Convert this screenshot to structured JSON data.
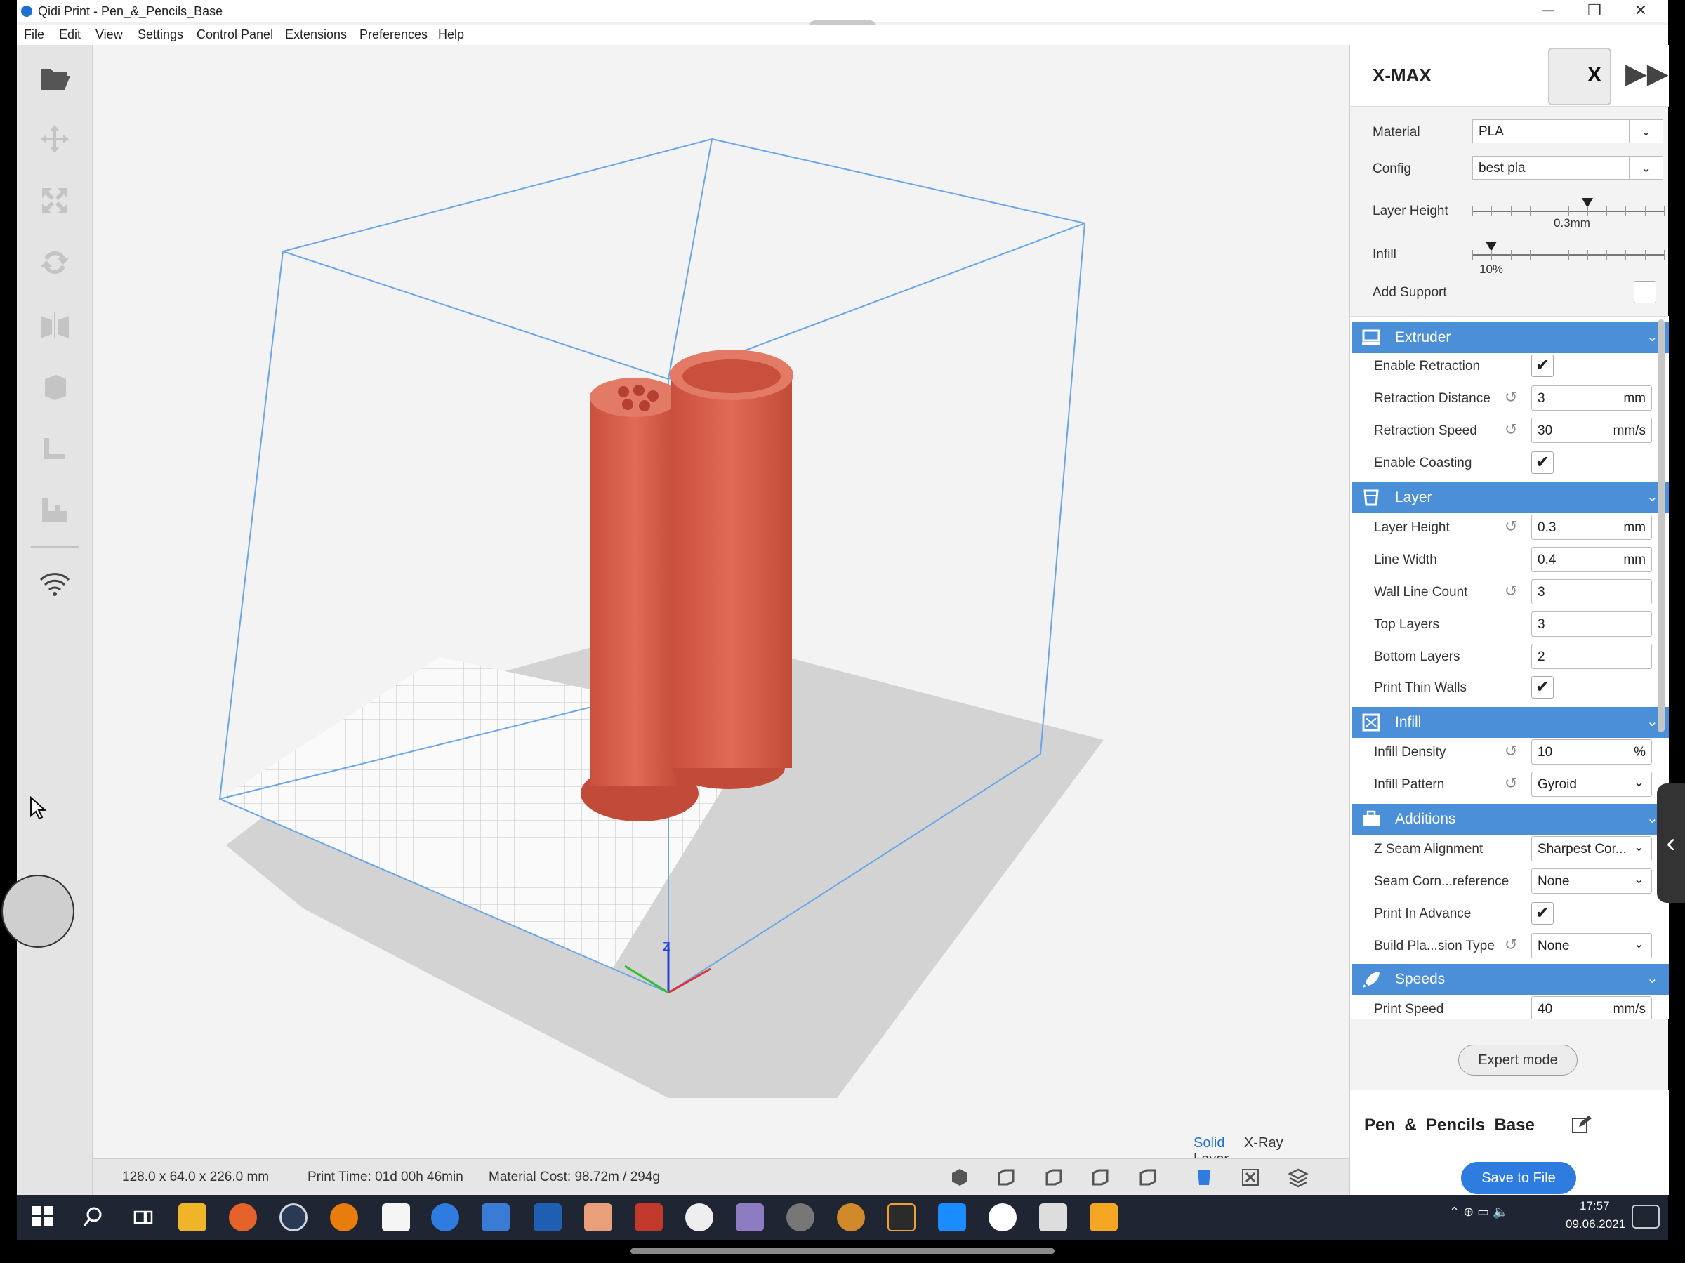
{
  "window": {
    "title": "Qidi Print - Pen_&_Pencils_Base",
    "controls": {
      "minimize": "─",
      "maximize": "❐",
      "close": "✕"
    }
  },
  "menu": [
    "File",
    "Edit",
    "View",
    "Settings",
    "Control Panel",
    "Extensions",
    "Preferences",
    "Help"
  ],
  "toolbar_icons": [
    "open-folder-icon",
    "move-icon",
    "scale-icon",
    "rotate-icon",
    "mirror-icon",
    "per-model-settings-icon",
    "support-blocker-icon",
    "multiply-icon",
    "wifi-icon"
  ],
  "viewport": {
    "view_modes": [
      "Solid",
      "X-Ray",
      "Layer"
    ],
    "active_view_mode": "Solid",
    "axis": {
      "z": "z"
    },
    "model_color": "#d9614c",
    "frame_color": "#6aa6e8"
  },
  "status": {
    "dimensions": "128.0 x 64.0 x 226.0 mm",
    "print_time": "Print Time: 01d 00h 46min",
    "material_cost": "Material Cost: 98.72m / 294g"
  },
  "view_buttons": [
    "3d-view-icon",
    "front-view-icon",
    "top-view-icon",
    "left-view-icon",
    "right-view-icon",
    "solid-mode-icon",
    "xray-mode-icon",
    "layer-mode-icon"
  ],
  "panel": {
    "printer": "X-MAX",
    "printer_badge": "X",
    "forward": "▶▶",
    "material_label": "Material",
    "material_value": "PLA",
    "config_label": "Config",
    "config_value": "best pla",
    "layer_height_label": "Layer Height",
    "layer_height_value": "0.3mm",
    "layer_height_level": 0.6,
    "infill_label": "Infill",
    "infill_value": "10%",
    "infill_level": 0.1,
    "add_support_label": "Add Support",
    "add_support_checked": false
  },
  "sections": {
    "extruder": "Extruder",
    "layer": "Layer",
    "infill": "Infill",
    "additions": "Additions",
    "speeds": "Speeds"
  },
  "settings": {
    "enable_retraction": {
      "label": "Enable Retraction",
      "check": "✔"
    },
    "retraction_distance": {
      "label": "Retraction Distance",
      "value": "3",
      "unit": "mm"
    },
    "retraction_speed": {
      "label": "Retraction Speed",
      "value": "30",
      "unit": "mm/s"
    },
    "enable_coasting": {
      "label": "Enable Coasting",
      "check": "✔"
    },
    "layer_height": {
      "label": "Layer Height",
      "value": "0.3",
      "unit": "mm"
    },
    "line_width": {
      "label": "Line Width",
      "value": "0.4",
      "unit": "mm"
    },
    "wall_line_count": {
      "label": "Wall Line Count",
      "value": "3"
    },
    "top_layers": {
      "label": "Top Layers",
      "value": "3"
    },
    "bottom_layers": {
      "label": "Bottom Layers",
      "value": "2"
    },
    "print_thin_walls": {
      "label": "Print Thin Walls",
      "check": "✔"
    },
    "infill_density": {
      "label": "Infill Density",
      "value": "10",
      "unit": "%"
    },
    "infill_pattern": {
      "label": "Infill Pattern",
      "value": "Gyroid"
    },
    "z_seam_alignment": {
      "label": "Z Seam Alignment",
      "value": "Sharpest Cor..."
    },
    "seam_corner_pref": {
      "label": "Seam Corn...reference",
      "value": "None"
    },
    "print_in_advance": {
      "label": "Print In Advance",
      "check": "✔"
    },
    "build_plate_adhesion": {
      "label": "Build Pla...sion Type",
      "value": "None"
    },
    "print_speed": {
      "label": "Print Speed",
      "value": "40",
      "unit": "mm/s"
    }
  },
  "footer": {
    "expert_mode": "Expert mode",
    "project_name": "Pen_&_Pencils_Base",
    "save": "Save to File"
  },
  "taskbar": {
    "apps": [
      "start",
      "search",
      "task-view",
      "file-explorer",
      "firefox",
      "steam",
      "blender",
      "xmind",
      "qidi-print",
      "visual-studio",
      "powershell",
      "character-creator",
      "prism",
      "mudbox",
      "substance",
      "xr-app",
      "zbrush",
      "fusion",
      "app-blue",
      "app-circle",
      "unity",
      "plasticity"
    ],
    "tray": "⌃ ⊕ ▭ 🔈",
    "time": "17:57",
    "date": "09.06.2021"
  }
}
